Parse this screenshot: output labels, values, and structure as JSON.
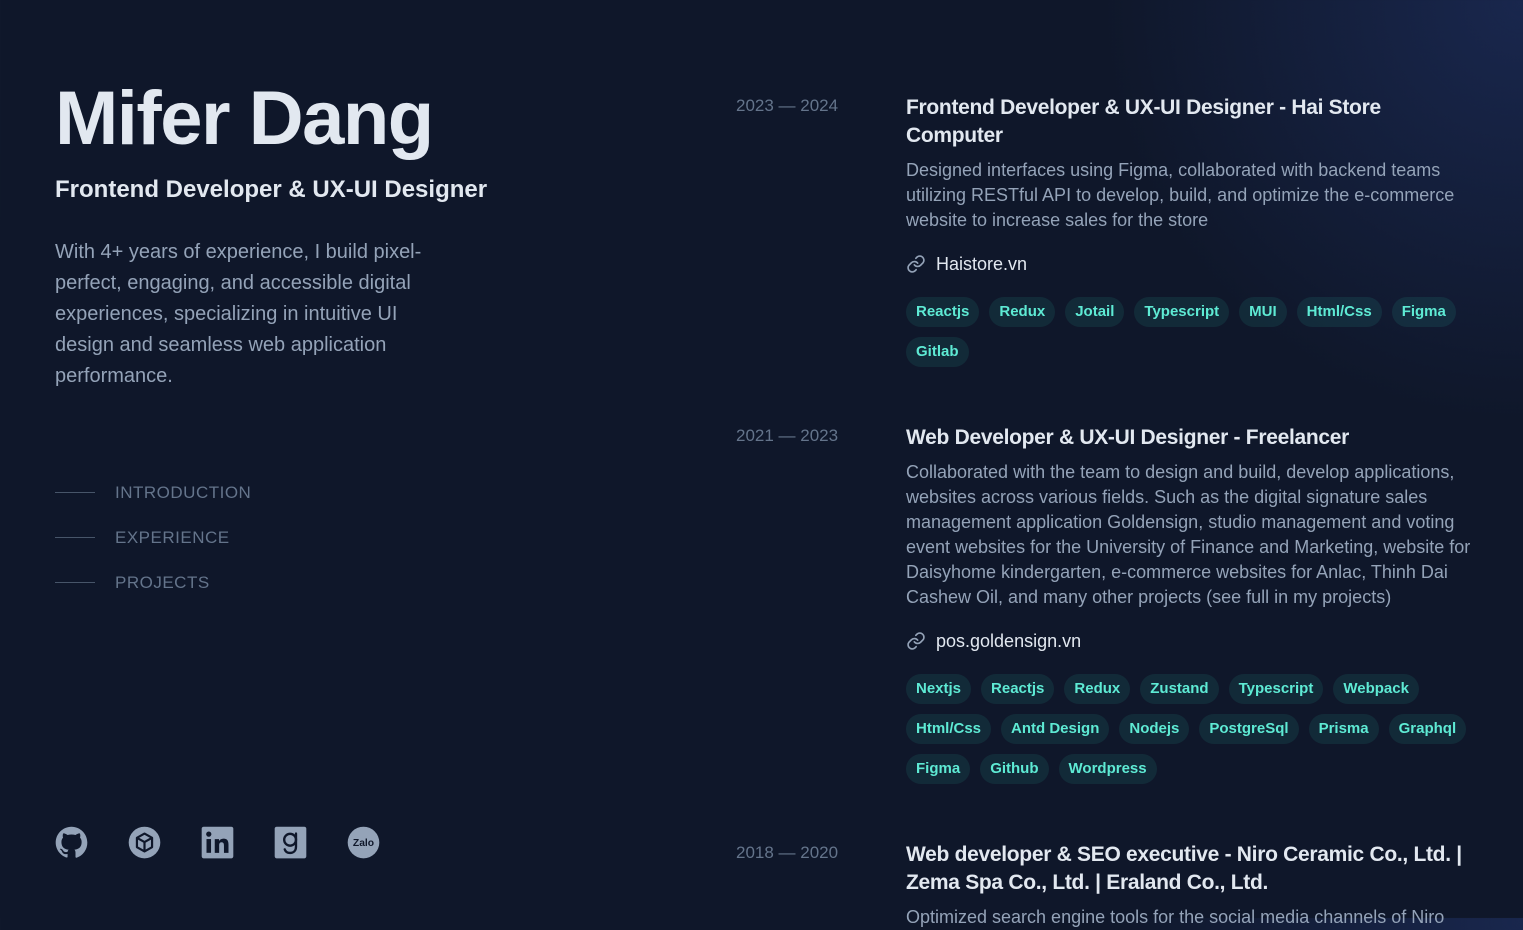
{
  "profile": {
    "name": "Mifer Dang",
    "role": "Frontend Developer & UX-UI Designer",
    "bio": "With 4+ years of experience, I build pixel-perfect, engaging, and accessible digital experiences, specializing in intuitive UI design and seamless web application performance."
  },
  "nav": {
    "items": [
      {
        "label": "INTRODUCTION"
      },
      {
        "label": "EXPERIENCE"
      },
      {
        "label": "PROJECTS"
      }
    ]
  },
  "socials": [
    {
      "icon": "github-icon"
    },
    {
      "icon": "codesandbox-icon"
    },
    {
      "icon": "linkedin-icon"
    },
    {
      "icon": "goodreads-icon"
    },
    {
      "icon": "zalo-icon",
      "label": "Zalo"
    }
  ],
  "experience": [
    {
      "period": "2023 — 2024",
      "title": "Frontend Developer & UX-UI Designer - Hai Store Computer",
      "description": "Designed interfaces using Figma, collaborated with backend teams utilizing RESTful API to develop, build, and optimize the e-commerce website to increase sales for the store",
      "link": "Haistore.vn",
      "tags": [
        "Reactjs",
        "Redux",
        "Jotail",
        "Typescript",
        "MUI",
        "Html/Css",
        "Figma",
        "Gitlab"
      ]
    },
    {
      "period": "2021 — 2023",
      "title": "Web Developer & UX-UI Designer - Freelancer",
      "description": "Collaborated with the team to design and build, develop applications, websites across various fields. Such as the digital signature sales management application Goldensign, studio management and voting event websites for the University of Finance and Marketing, website for Daisyhome kindergarten, e-commerce websites for Anlac, Thinh Dai Cashew Oil, and many other projects (see full in my projects)",
      "link": "pos.goldensign.vn",
      "tags": [
        "Nextjs",
        "Reactjs",
        "Redux",
        "Zustand",
        "Typescript",
        "Webpack",
        "Html/Css",
        "Antd Design",
        "Nodejs",
        "PostgreSql",
        "Prisma",
        "Graphql",
        "Figma",
        "Github",
        "Wordpress"
      ]
    },
    {
      "period": "2018 — 2020",
      "title": "Web developer & SEO executive - Niro Ceramic Co., Ltd. | Zema Spa Co., Ltd. | Eraland Co., Ltd.",
      "description": "Optimized search engine tools for the social media channels of Niro"
    }
  ],
  "colors": {
    "background": "#0f172a",
    "heading": "#e2e8f0",
    "body_text": "#94a3b8",
    "muted": "#64748b",
    "accent": "#5eead4",
    "tag_bg": "rgba(45,212,191,0.1)"
  }
}
